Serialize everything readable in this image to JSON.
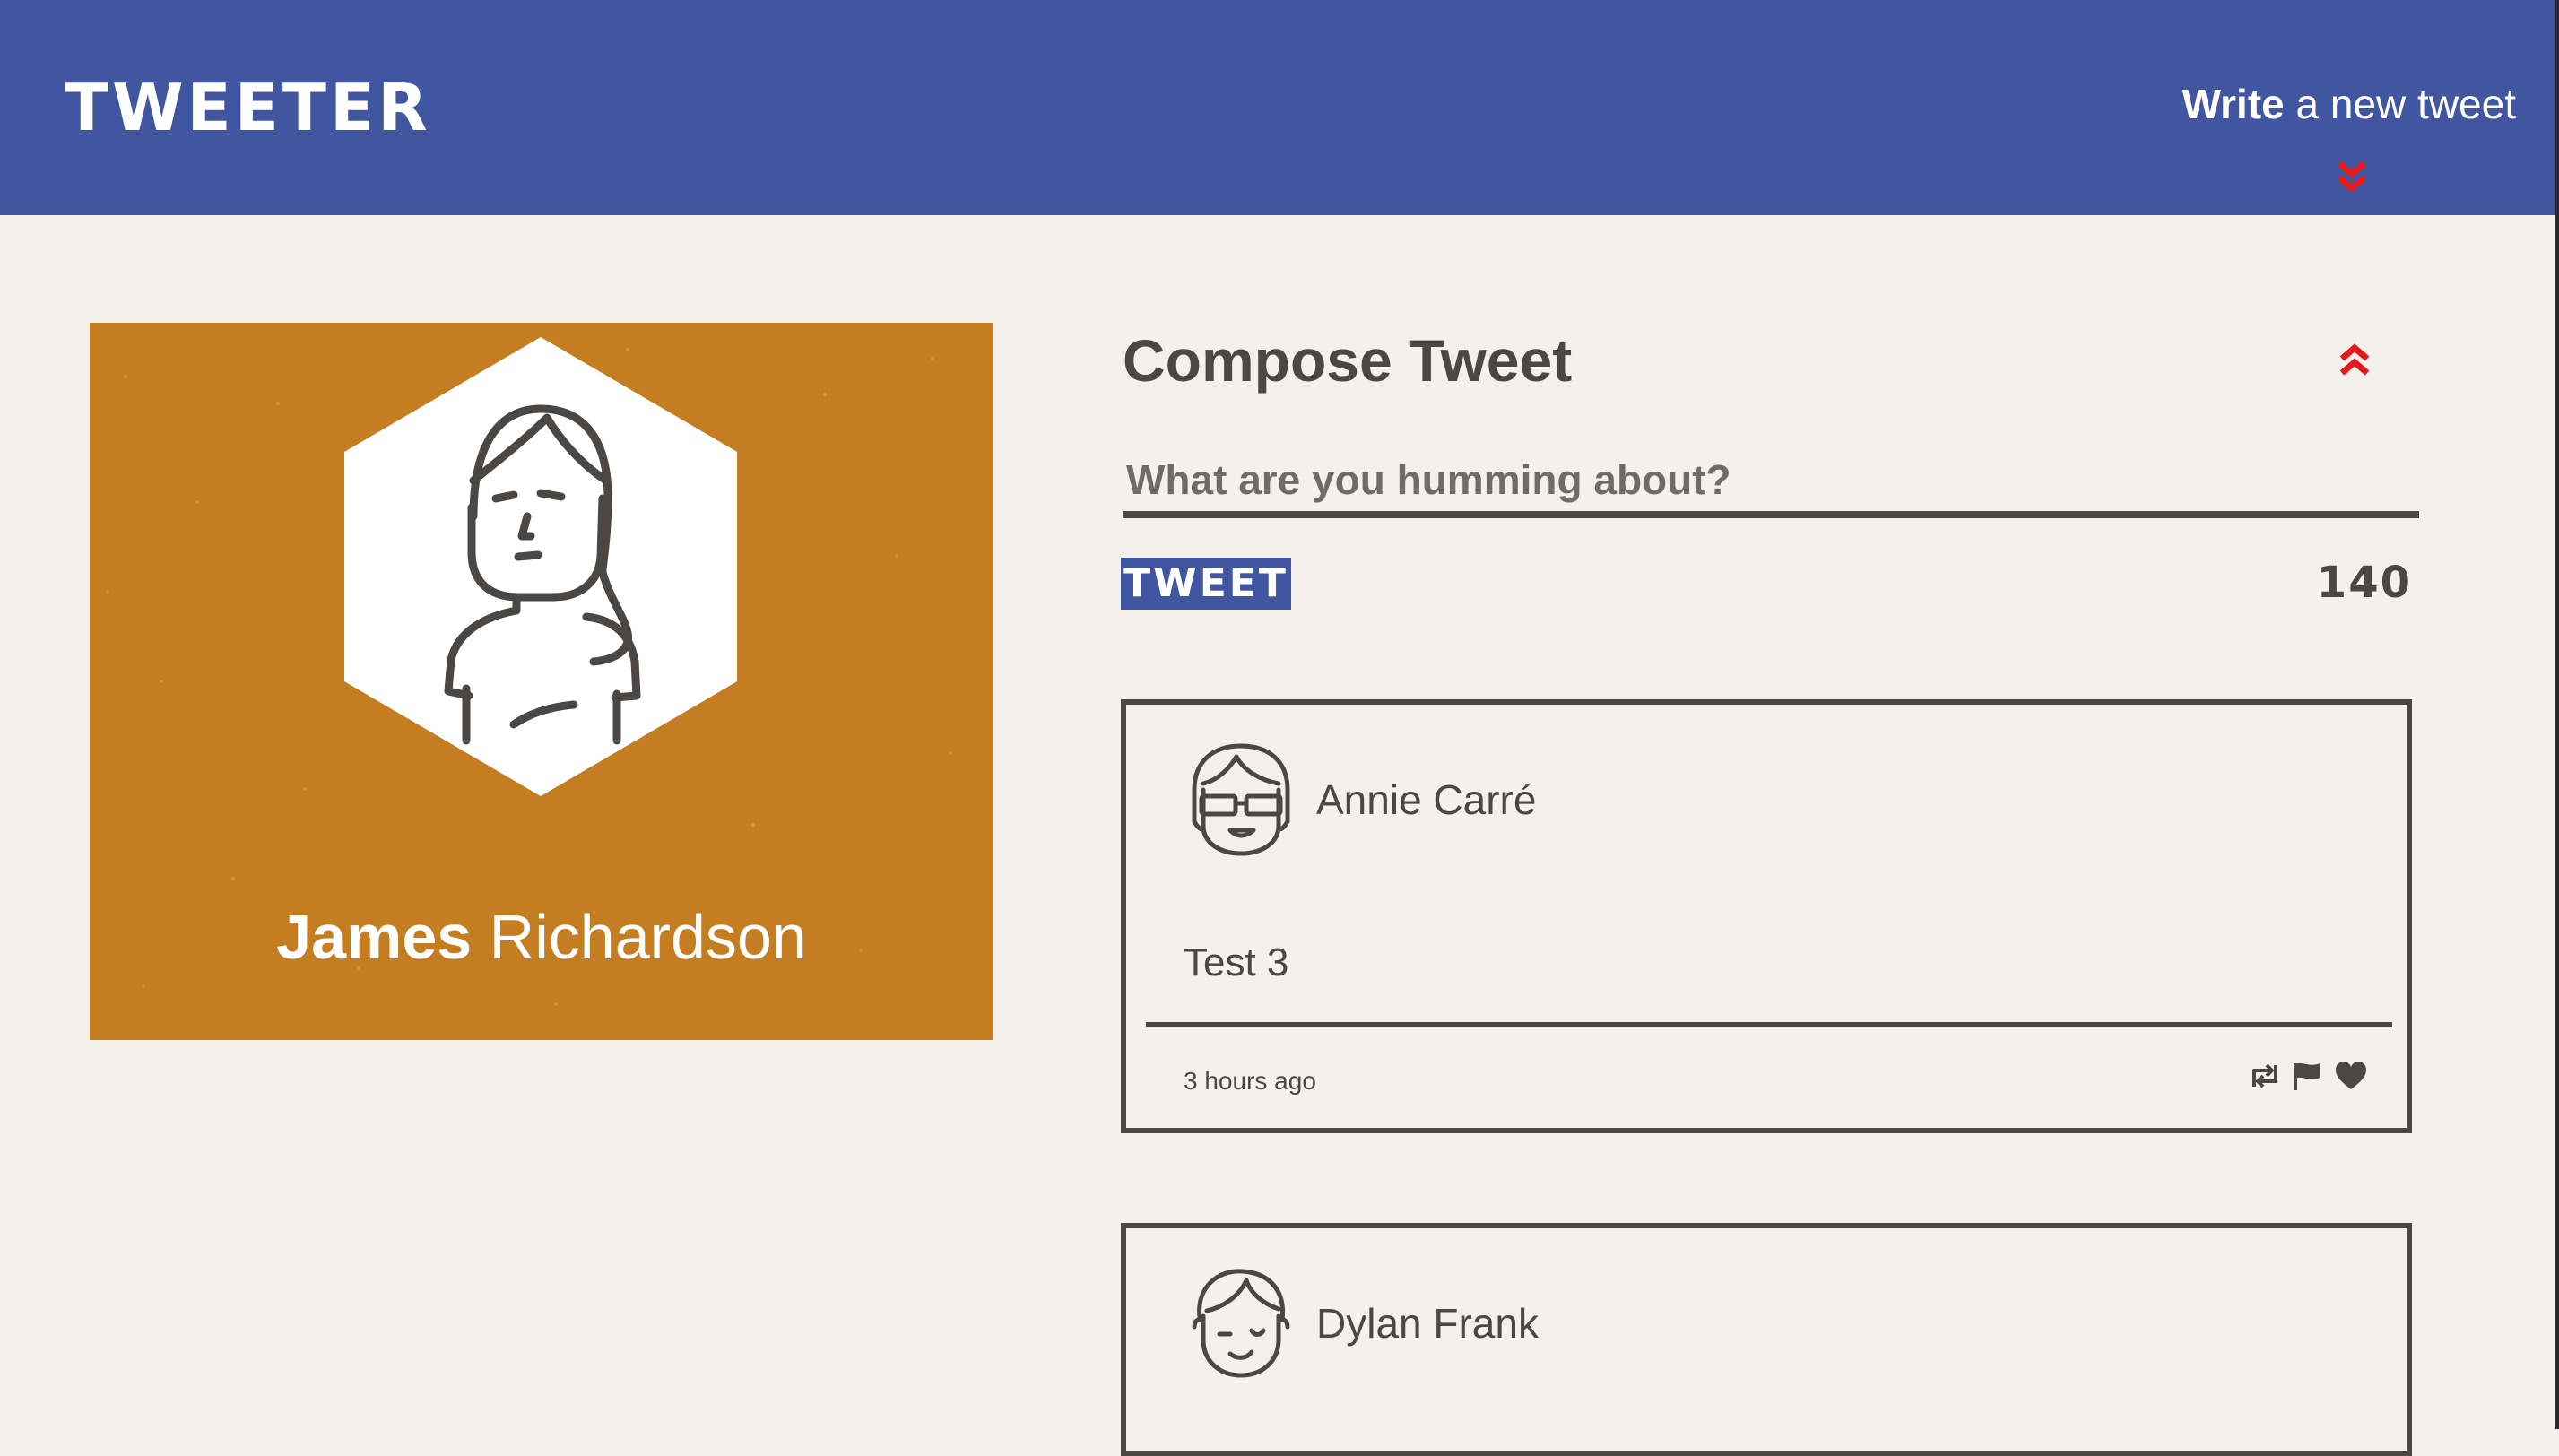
{
  "nav": {
    "logo": "TWEETER",
    "write_bold": "Write",
    "write_rest": " a new tweet",
    "chevron_icon": "double-chevron-down-icon",
    "chevron_color": "#e31b1b"
  },
  "profile": {
    "first_name": "James",
    "last_name": "Richardson",
    "background_color": "#c47d20",
    "avatar_icon": "female-avatar-icon"
  },
  "compose": {
    "title": "Compose Tweet",
    "toggle_icon": "double-chevron-up-icon",
    "placeholder": "What are you humming about?",
    "button_label": "TWEET",
    "counter": "140"
  },
  "tweets": [
    {
      "author": "Annie Carré",
      "avatar_icon": "girl-with-glasses-avatar-icon",
      "content": "Test 3",
      "time": "3 hours ago",
      "actions": [
        "retweet-icon",
        "flag-icon",
        "heart-icon"
      ]
    },
    {
      "author": "Dylan Frank",
      "avatar_icon": "boy-winking-avatar-icon",
      "content": "",
      "time": ""
    }
  ],
  "colors": {
    "nav": "#4056a1",
    "page_background": "#f4f1ec",
    "text": "#4a4744",
    "accent_red": "#e31b1b"
  }
}
